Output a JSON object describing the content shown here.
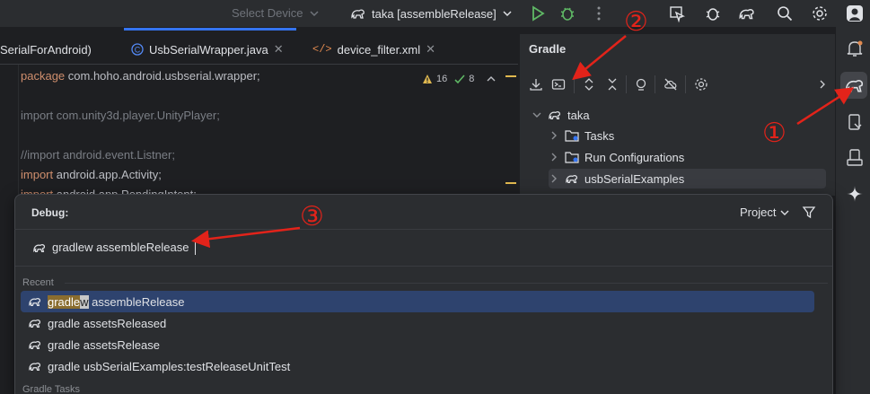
{
  "toolbar": {
    "select_device": "Select Device",
    "run_config_label": "taka [assembleRelease]",
    "icons": [
      "run-icon",
      "debug-icon",
      "more-icon",
      "profiler-icon",
      "bug-icon",
      "gradle-icon",
      "search-icon",
      "gear-icon",
      "avatar-icon"
    ]
  },
  "editor": {
    "tabs": [
      {
        "label": "SerialForAndroid)",
        "active": false
      },
      {
        "label": "UsbSerialWrapper.java",
        "active": true
      },
      {
        "label": "device_filter.xml",
        "active": false
      }
    ],
    "inspection": {
      "warnings": "16",
      "ok": "8"
    },
    "code_lines": [
      {
        "kw": "package",
        "rest": " com.hoho.android.usbserial.wrapper;"
      },
      {
        "kw": "",
        "rest": ""
      },
      {
        "kw": "import",
        "rest": " com.unity3d.player.UnityPlayer;",
        "dim": true
      },
      {
        "kw": "",
        "rest": ""
      },
      {
        "kw": "",
        "rest": "//import android.event.Listner;",
        "comment": true
      },
      {
        "kw": "import",
        "rest": " android.app.Activity;"
      },
      {
        "kw": "import",
        "rest": " android.app.PendingIntent;"
      }
    ]
  },
  "gradle": {
    "title": "Gradle",
    "tree": {
      "root": "taka",
      "children": [
        "Tasks",
        "Run Configurations",
        "usbSerialExamples"
      ]
    }
  },
  "popup": {
    "title": "Debug:",
    "scope": "Project",
    "search_value": "gradlew assembleRelease",
    "recent_label": "Recent",
    "recent": [
      {
        "pre_hl": "gradle",
        "hl2": "w",
        "rest": " assembleRelease",
        "selected": true
      },
      {
        "text": "gradle assetsReleased"
      },
      {
        "text": "gradle assetsRelease"
      },
      {
        "text": "gradle usbSerialExamples:testReleaseUnitTest"
      }
    ],
    "gradle_tasks_label": "Gradle Tasks"
  },
  "annotations": {
    "one": "①",
    "two": "②",
    "three": "③"
  },
  "colors": {
    "accent": "#3574f0",
    "annotation": "#e2231a",
    "run_green": "#5fb865",
    "selection": "#2e436e"
  }
}
